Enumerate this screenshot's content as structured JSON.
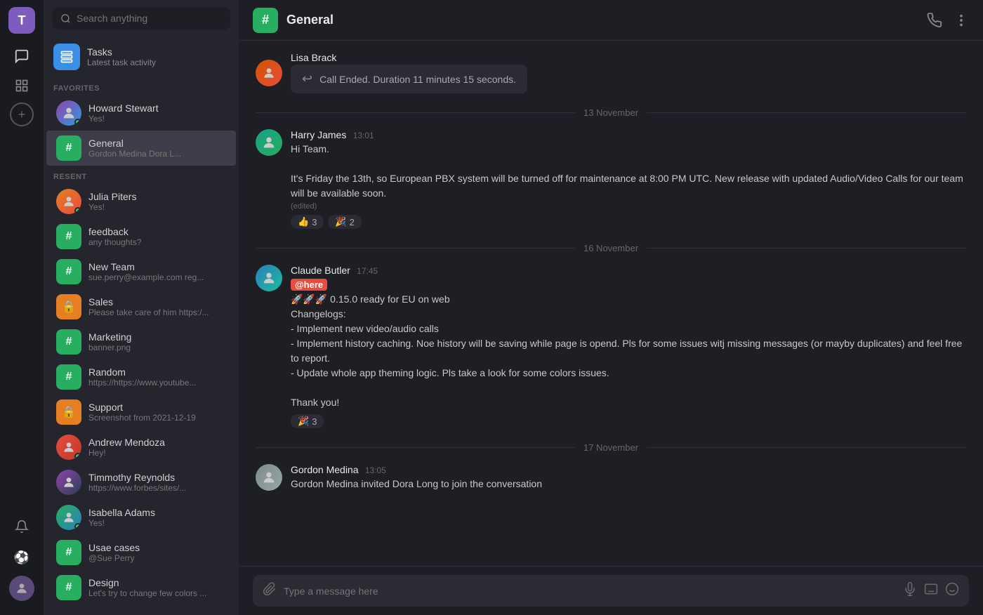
{
  "rail": {
    "user_initial": "T",
    "icons": [
      {
        "name": "chat-icon",
        "glyph": "💬"
      },
      {
        "name": "grid-icon",
        "glyph": "⊞"
      },
      {
        "name": "add-icon",
        "glyph": "+"
      }
    ],
    "bottom_icons": [
      {
        "name": "bell-icon",
        "glyph": "🔔"
      },
      {
        "name": "soccer-icon",
        "glyph": "⚽"
      }
    ]
  },
  "sidebar": {
    "search_placeholder": "Search anything",
    "tasks": {
      "title": "Tasks",
      "subtitle": "Latest task activity"
    },
    "favorites_label": "FAVORITES",
    "favorites": [
      {
        "name": "Howard Stewart",
        "sub": "Yes!",
        "type": "person",
        "online": true
      },
      {
        "name": "General",
        "sub": "Gordon Medina Dora L...",
        "type": "channel",
        "active": true
      }
    ],
    "recent_label": "RESENT",
    "recent": [
      {
        "name": "Julia Piters",
        "sub": "Yes!",
        "type": "person",
        "online": true
      },
      {
        "name": "feedback",
        "sub": "any thoughts?",
        "type": "channel"
      },
      {
        "name": "New Team",
        "sub": "sue.perry@example.com reg...",
        "type": "channel"
      },
      {
        "name": "Sales",
        "sub": "Please take care of him https:/...",
        "type": "lock"
      },
      {
        "name": "Marketing",
        "sub": "banner.png",
        "type": "channel"
      },
      {
        "name": "Random",
        "sub": "https://https://www.youtube...",
        "type": "channel"
      },
      {
        "name": "Support",
        "sub": "Screenshot from 2021-12-19",
        "type": "lock"
      },
      {
        "name": "Andrew Mendoza",
        "sub": "Hey!",
        "type": "person",
        "online": true
      },
      {
        "name": "Timmothy Reynolds",
        "sub": "https://www.forbes/sites/...",
        "type": "person"
      },
      {
        "name": "Isabella Adams",
        "sub": "Yes!",
        "type": "person",
        "online": true
      },
      {
        "name": "Usae cases",
        "sub": "@Sue Perry",
        "type": "channel"
      },
      {
        "name": "Design",
        "sub": "Let's try to change few colors ...",
        "type": "channel"
      }
    ]
  },
  "chat": {
    "title": "General",
    "header_icon": "#",
    "call_ended": {
      "speaker_name": "Lisa Brack",
      "text": "Call Ended. Duration 11 minutes 15 seconds."
    },
    "dates": {
      "date1": "13 November",
      "date2": "16  November",
      "date3": "17  November"
    },
    "messages": [
      {
        "id": "msg1",
        "sender": "Harry James",
        "time": "13:01",
        "lines": [
          "Hi Team.",
          "",
          "It's Friday the 13th, so European PBX system will be turned off for maintenance at 8:00 PM UTC. New release with updated Audio/Video Calls for our team will be available soon."
        ],
        "edited": true,
        "reactions": [
          {
            "emoji": "👍",
            "count": "3"
          },
          {
            "emoji": "🎉",
            "count": "2"
          }
        ]
      },
      {
        "id": "msg2",
        "sender": "Claude Butler",
        "time": "17:45",
        "mention": "@here",
        "lines": [
          "🚀🚀🚀 0.15.0 ready for EU on web",
          "Changelogs:",
          "- Implement new video/audio calls",
          "- Implement history caching. Noe history will be saving while page is opend. Pls for some issues witj missing messages (or mayby duplicates) and  feel free to report.",
          "- Update whole app theming logic. Pls take a look for some colors issues.",
          "",
          "Thank you!"
        ],
        "reactions": [
          {
            "emoji": "🎉",
            "count": "3"
          }
        ]
      },
      {
        "id": "msg3",
        "sender": "Gordon Medina",
        "time": "13:05",
        "lines": [
          "Gordon Medina invited Dora Long to join the conversation"
        ]
      }
    ],
    "input_placeholder": "Type a message here"
  }
}
